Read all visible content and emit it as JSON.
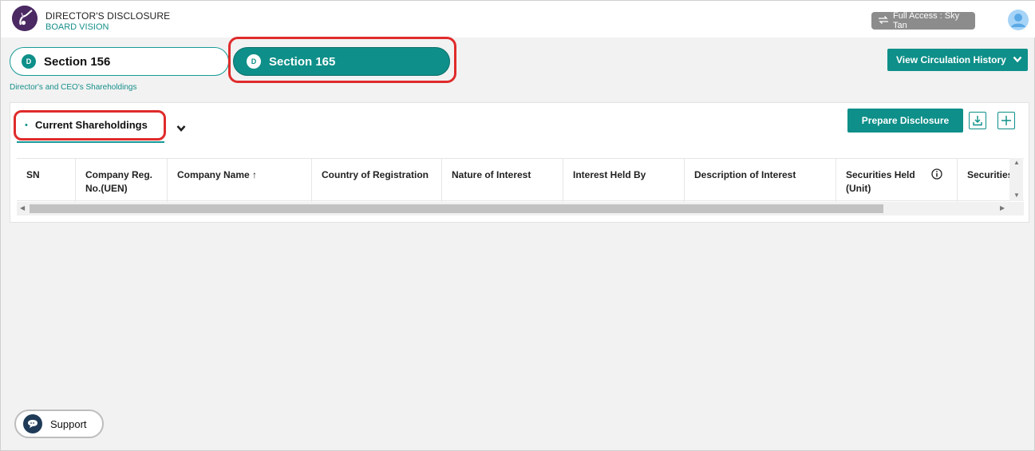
{
  "header": {
    "title": "DIRECTOR'S DISCLOSURE",
    "subtitle": "BOARD VISION",
    "access_label": "Full Access : Sky Tan",
    "logo_icon": "board-vision-logo",
    "avatar_icon": "user-avatar-icon"
  },
  "tabs": [
    {
      "badge": "D",
      "label": "Section 156",
      "active": false
    },
    {
      "badge": "D",
      "label": "Section 165",
      "active": true
    }
  ],
  "page_subtitle": "Director's and CEO's Shareholdings",
  "toolbar": {
    "circulation_label": "View Circulation History",
    "prepare_label": "Prepare Disclosure",
    "download_icon": "download-icon",
    "add_icon": "plus-icon"
  },
  "section": {
    "label": "Current Shareholdings",
    "bullet": "•"
  },
  "table": {
    "columns": [
      {
        "label": "SN"
      },
      {
        "label": "Company Reg. No.(UEN)"
      },
      {
        "label": "Company Name ↑"
      },
      {
        "label": "Country of Registration"
      },
      {
        "label": "Nature of Interest"
      },
      {
        "label": "Interest Held By"
      },
      {
        "label": "Description of Interest"
      },
      {
        "label": "Securities Held (Unit)"
      },
      {
        "label": "Securities"
      }
    ],
    "rows": []
  },
  "support": {
    "label": "Support",
    "icon": "chat-bubble-icon"
  },
  "colors": {
    "accent": "#0e8f89",
    "highlight": "#e02b2b"
  }
}
